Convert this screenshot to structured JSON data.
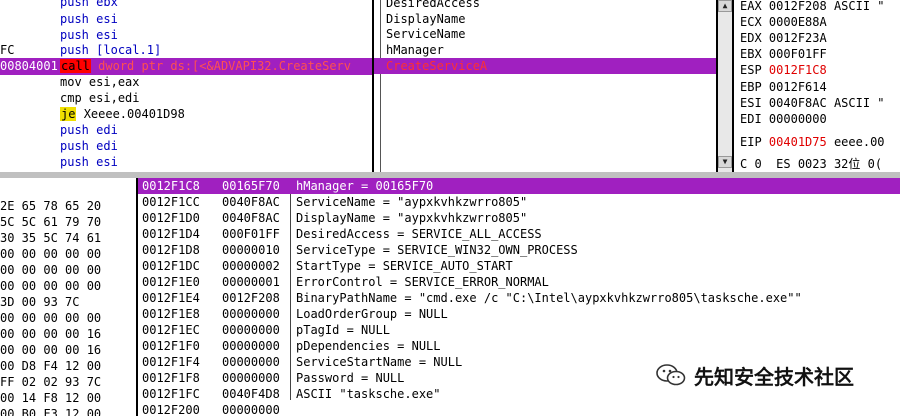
{
  "disasm": {
    "rows": [
      {
        "addr": "",
        "mn": "push",
        "op": "ebx"
      },
      {
        "addr": "",
        "mn": "push",
        "op": "esi"
      },
      {
        "addr": "",
        "mn": "push",
        "op": "esi"
      },
      {
        "addr": "FC",
        "mn": "push",
        "op": "[local.1]"
      },
      {
        "addr": "00804001",
        "mn": "call",
        "op": "dword ptr ds:[<&ADVAPI32.CreateServ"
      },
      {
        "addr": "",
        "mn": "mov",
        "op": "esi,eax"
      },
      {
        "addr": "",
        "mn": "cmp",
        "op": "esi,edi"
      },
      {
        "addr": "",
        "mn": "je",
        "op": "Xeeee.00401D98"
      },
      {
        "addr": "",
        "mn": "push",
        "op": "edi"
      },
      {
        "addr": "",
        "mn": "push",
        "op": "edi"
      },
      {
        "addr": "",
        "mn": "push",
        "op": "esi"
      }
    ]
  },
  "hint": {
    "rows": [
      "DesiredAccess",
      "DisplayName",
      "ServiceName",
      "hManager",
      "CreateServiceA"
    ]
  },
  "registers": {
    "rows": [
      {
        "name": "EAX",
        "val": "0012F208",
        "extra": "ASCII \""
      },
      {
        "name": "ECX",
        "val": "0000E88A",
        "extra": ""
      },
      {
        "name": "EDX",
        "val": "0012F23A",
        "extra": ""
      },
      {
        "name": "EBX",
        "val": "000F01FF",
        "extra": ""
      },
      {
        "name": "ESP",
        "val": "0012F1C8",
        "extra": ""
      },
      {
        "name": "EBP",
        "val": "0012F614",
        "extra": ""
      },
      {
        "name": "ESI",
        "val": "0040F8AC",
        "extra": "ASCII \""
      },
      {
        "name": "EDI",
        "val": "00000000",
        "extra": ""
      },
      {
        "name": "EIP",
        "val": "00401D75",
        "extra": "eeee.00"
      },
      {
        "name": "C 0",
        "val": "ES 0023",
        "extra": "32位 0("
      }
    ]
  },
  "dump": {
    "rows": [
      "2E 65 78 65 20",
      "5C 5C 61 79 70",
      "30 35 5C 74 61",
      "00 00 00 00 00",
      "00 00 00 00 00",
      "00 00 00 00 00",
      "3D 00 93 7C",
      "00 00 00 00 00",
      "00 00 00 00 16",
      "00 00 00 00 16",
      "00 D8 F4 12 00",
      "FF 02 02 93 7C",
      "00 14 F8 12 00",
      "00 B0 F3 12 00"
    ]
  },
  "stack": {
    "rows": [
      {
        "addr": "0012F1C8",
        "val": "00165F70",
        "desc": "hManager = 00165F70"
      },
      {
        "addr": "0012F1CC",
        "val": "0040F8AC",
        "desc": "ServiceName = \"aypxkvhkzwrro805\""
      },
      {
        "addr": "0012F1D0",
        "val": "0040F8AC",
        "desc": "DisplayName = \"aypxkvhkzwrro805\""
      },
      {
        "addr": "0012F1D4",
        "val": "000F01FF",
        "desc": "DesiredAccess = SERVICE_ALL_ACCESS"
      },
      {
        "addr": "0012F1D8",
        "val": "00000010",
        "desc": "ServiceType = SERVICE_WIN32_OWN_PROCESS"
      },
      {
        "addr": "0012F1DC",
        "val": "00000002",
        "desc": "StartType = SERVICE_AUTO_START"
      },
      {
        "addr": "0012F1E0",
        "val": "00000001",
        "desc": "ErrorControl = SERVICE_ERROR_NORMAL"
      },
      {
        "addr": "0012F1E4",
        "val": "0012F208",
        "desc": "BinaryPathName = \"cmd.exe /c \"C:\\Intel\\aypxkvhkzwrro805\\tasksche.exe\"\""
      },
      {
        "addr": "0012F1E8",
        "val": "00000000",
        "desc": "LoadOrderGroup = NULL"
      },
      {
        "addr": "0012F1EC",
        "val": "00000000",
        "desc": "pTagId = NULL"
      },
      {
        "addr": "0012F1F0",
        "val": "00000000",
        "desc": "pDependencies = NULL"
      },
      {
        "addr": "0012F1F4",
        "val": "00000000",
        "desc": "ServiceStartName = NULL"
      },
      {
        "addr": "0012F1F8",
        "val": "00000000",
        "desc": "Password = NULL"
      },
      {
        "addr": "0012F1FC",
        "val": "0040F4D8",
        "desc": "ASCII \"tasksche.exe\""
      },
      {
        "addr": "0012F200",
        "val": "00000000",
        "desc": ""
      }
    ]
  },
  "watermark": {
    "text": "先知安全技术社区"
  },
  "colors": {
    "selection": "#a020c0",
    "highlight_red": "#e00000",
    "mnemonic_blue": "#0000c0"
  }
}
